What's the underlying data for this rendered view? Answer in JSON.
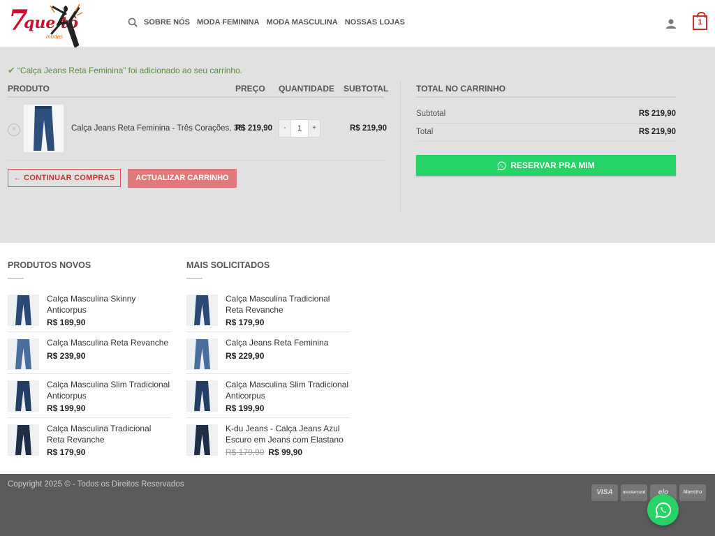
{
  "brand": {
    "logo_number": "7",
    "logo_word": "que tô",
    "logo_sub": "modas"
  },
  "nav": {
    "items": [
      "SOBRE NÓS",
      "MODA FEMININA",
      "MODA MASCULINA",
      "NOSSAS LOJAS"
    ],
    "cart_count": "1"
  },
  "notice": {
    "text": "“Calça Jeans Reta Feminina” foi adicionado ao seu carrinho."
  },
  "cart": {
    "headers": {
      "product": "PRODUTO",
      "price": "PREÇO",
      "quantity": "QUANTIDADE",
      "subtotal": "SUBTOTAL"
    },
    "item": {
      "name": "Calça Jeans Reta Feminina - Três Corações, 36",
      "price": "R$ 219,90",
      "quantity": "1",
      "subtotal": "R$ 219,90",
      "minus": "-",
      "plus": "+",
      "remove": "×"
    },
    "continue_label": "← CONTINUAR COMPRAS",
    "update_label": "ACTUALIZAR CARRINHO"
  },
  "totals": {
    "title": "TOTAL NO CARRINHO",
    "subtotal_label": "Subtotal",
    "subtotal_value": "R$ 219,90",
    "total_label": "Total",
    "total_value": "R$ 219,90",
    "reserve_label": "RESERVAR PRA MIM"
  },
  "new_products": {
    "title": "PRODUTOS NOVOS",
    "items": [
      {
        "name": "Calça Masculina Skinny Anticorpus",
        "price": "R$ 189,90"
      },
      {
        "name": "Calça Masculina Reta Revanche",
        "price": "R$ 239,90"
      },
      {
        "name": "Calça Masculina Slim Tradicional Anticorpus",
        "price": "R$ 199,90"
      },
      {
        "name": "Calça Masculina Tradicional Reta Revanche",
        "price": "R$ 179,90"
      }
    ]
  },
  "most_requested": {
    "title": "MAIS SOLICITADOS",
    "items": [
      {
        "name": "Calça Masculina Tradicional Reta Revanche",
        "price": "R$ 179,90"
      },
      {
        "name": "Calça Jeans Reta Feminina",
        "price": "R$ 229,90"
      },
      {
        "name": "Calça Masculina Slim Tradicional Anticorpus",
        "price": "R$ 199,90"
      },
      {
        "name": "K-du Jeans - Calça Jeans Azul Escuro em Jeans com Elastano",
        "old_price": "R$ 179,90",
        "price": "R$ 99,90"
      }
    ]
  },
  "footer": {
    "copyright": "Copyright 2025 © - Todos os Direitos Reservados",
    "payments": [
      "VISA",
      "mastercard",
      "elo",
      "Maestro"
    ]
  },
  "colors": {
    "accent_red": "#c9302c",
    "whatsapp_green": "#25d366",
    "cart_bg": "#e1e1e1",
    "footer_bg": "#5b5b5b"
  },
  "icons": [
    "search-icon",
    "user-icon",
    "cart-icon",
    "check-icon",
    "remove-icon",
    "whatsapp-icon"
  ]
}
